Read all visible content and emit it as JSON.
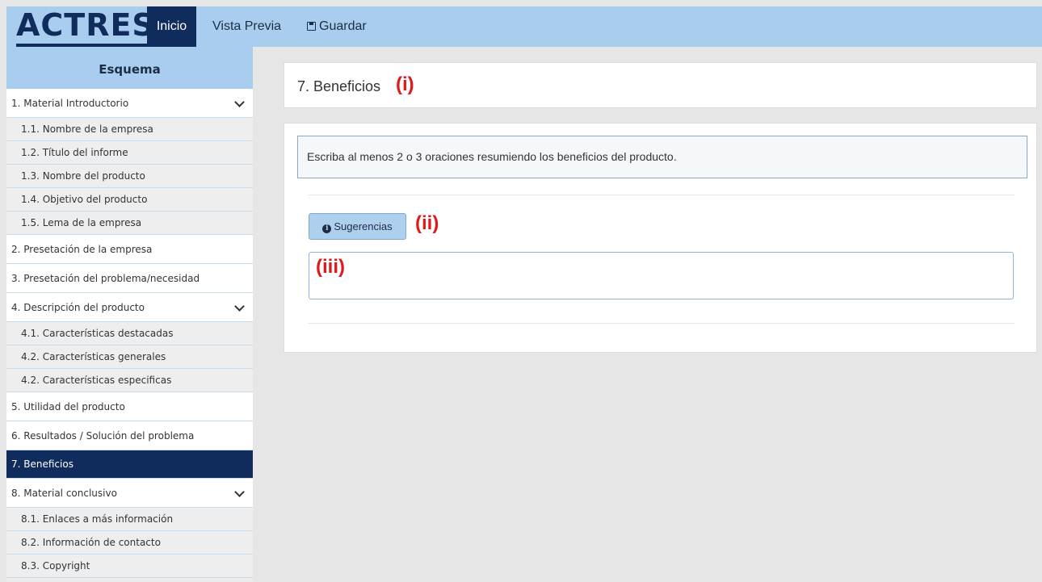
{
  "app": {
    "logo": "ACTRES",
    "nav": {
      "inicio": "Inicio",
      "vista_previa": "Vista Previa",
      "guardar": "Guardar"
    }
  },
  "sidebar": {
    "title": "Esquema",
    "items": [
      {
        "label": "1. Material Introductorio",
        "level": "main",
        "expandable": true
      },
      {
        "label": "1.1. Nombre de la empresa",
        "level": "sub"
      },
      {
        "label": "1.2. Título del informe",
        "level": "sub"
      },
      {
        "label": "1.3. Nombre del producto",
        "level": "sub"
      },
      {
        "label": "1.4. Objetivo del producto",
        "level": "sub"
      },
      {
        "label": "1.5. Lema de la empresa",
        "level": "sub"
      },
      {
        "label": "2. Presetación de la empresa",
        "level": "main"
      },
      {
        "label": "3. Presetación del problema/necesidad",
        "level": "main"
      },
      {
        "label": "4. Descripción del producto",
        "level": "main",
        "expandable": true
      },
      {
        "label": "4.1. Características destacadas",
        "level": "sub"
      },
      {
        "label": "4.2. Características generales",
        "level": "sub"
      },
      {
        "label": "4.2. Características especificas",
        "level": "sub"
      },
      {
        "label": "5. Utilidad del producto",
        "level": "main"
      },
      {
        "label": "6. Resultados / Solución del problema",
        "level": "main"
      },
      {
        "label": "7. Beneficios",
        "level": "main",
        "active": true
      },
      {
        "label": "8. Material conclusivo",
        "level": "main",
        "expandable": true
      },
      {
        "label": "8.1. Enlaces a más información",
        "level": "sub"
      },
      {
        "label": "8.2. Información de contacto",
        "level": "sub"
      },
      {
        "label": "8.3. Copyright",
        "level": "sub"
      }
    ]
  },
  "main": {
    "title": "7. Beneficios",
    "title_marker": "(i)",
    "instructions": "Escriba al menos 2 o 3 oraciones resumiendo los beneficios del producto.",
    "suggestions_button": "Sugerencias",
    "suggestions_marker": "(ii)",
    "textarea_marker": "(iii)"
  },
  "colors": {
    "accent_dark": "#0f2c5c",
    "header_bg": "#a9cdee",
    "marker_red": "#e0191b"
  }
}
